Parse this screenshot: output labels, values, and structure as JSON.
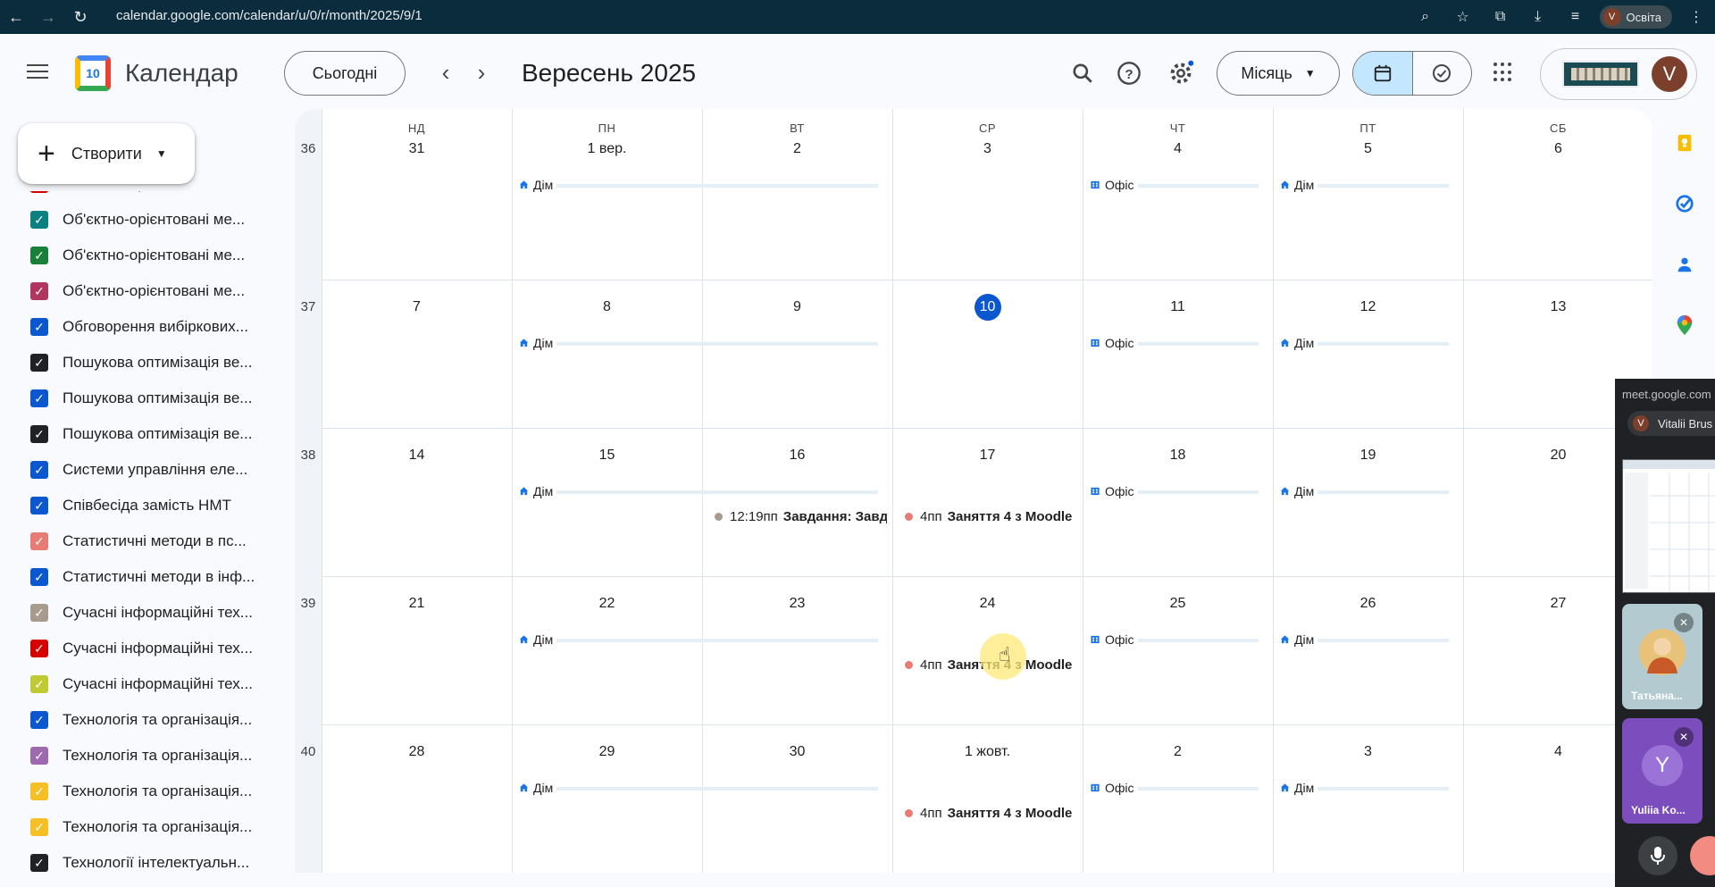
{
  "browser": {
    "url": "calendar.google.com/calendar/u/0/r/month/2025/9/1",
    "profile_initial": "V",
    "profile_name": "Освіта"
  },
  "header": {
    "app_title": "Календар",
    "logo_day": "10",
    "today_label": "Сьогодні",
    "month_title": "Вересень 2025",
    "view_label": "Місяць",
    "account_initial": "V"
  },
  "sidebar": {
    "create_label": "Створити",
    "calendars": [
      {
        "label": "Об'єктно-орієнтовані ме...",
        "color": "#d50000"
      },
      {
        "label": "Об'єктно-орієнтовані ме...",
        "color": "#0b8080"
      },
      {
        "label": "Об'єктно-орієнтовані ме...",
        "color": "#188038"
      },
      {
        "label": "Об'єктно-орієнтовані ме...",
        "color": "#b1365f"
      },
      {
        "label": "Обговорення вибіркових...",
        "color": "#0b57d0"
      },
      {
        "label": "Пошукова оптимізація ве...",
        "color": "#202124"
      },
      {
        "label": "Пошукова оптимізація ве...",
        "color": "#0b57d0"
      },
      {
        "label": "Пошукова оптимізація ве...",
        "color": "#202124"
      },
      {
        "label": "Системи управління еле...",
        "color": "#0b57d0"
      },
      {
        "label": "Співбесіда замість НМТ",
        "color": "#0b57d0"
      },
      {
        "label": "Статистичні методи в пс...",
        "color": "#e67c73"
      },
      {
        "label": "Статистичні методи в інф...",
        "color": "#0b57d0"
      },
      {
        "label": "Сучасні інформаційні тех...",
        "color": "#a79b8e"
      },
      {
        "label": "Сучасні інформаційні тех...",
        "color": "#d50000"
      },
      {
        "label": "Сучасні інформаційні тех...",
        "color": "#c0ca33"
      },
      {
        "label": "Технологія та організація...",
        "color": "#0b57d0"
      },
      {
        "label": "Технологія та організація...",
        "color": "#9e69af"
      },
      {
        "label": "Технологія та організація...",
        "color": "#f6bf26"
      },
      {
        "label": "Технологія та організація...",
        "color": "#f6bf26"
      },
      {
        "label": "Технології інтелектуальн...",
        "color": "#202124"
      }
    ]
  },
  "calendar": {
    "weekdays": [
      "НД",
      "ПН",
      "ВТ",
      "СР",
      "ЧТ",
      "ПТ",
      "СБ"
    ],
    "weeks": [
      {
        "num": "36",
        "days": [
          "31",
          "1 вер.",
          "2",
          "3",
          "4",
          "5",
          "6"
        ]
      },
      {
        "num": "37",
        "days": [
          "7",
          "8",
          "9",
          "10",
          "11",
          "12",
          "13"
        ]
      },
      {
        "num": "38",
        "days": [
          "14",
          "15",
          "16",
          "17",
          "18",
          "19",
          "20"
        ]
      },
      {
        "num": "39",
        "days": [
          "21",
          "22",
          "23",
          "24",
          "25",
          "26",
          "27"
        ]
      },
      {
        "num": "40",
        "days": [
          "28",
          "29",
          "30",
          "1 жовт.",
          "2",
          "3",
          "4"
        ]
      }
    ],
    "today": "10",
    "location_home": "Дім",
    "location_office": "Офіс",
    "events": {
      "task_time": "12:19пп",
      "task_title": "Завдання: Завдання",
      "class_time": "4пп",
      "class_title": "Заняття 4 з Moodle"
    }
  },
  "meet": {
    "url": "meet.google.com",
    "user_initial": "V",
    "user_name": "Vitalii Brus",
    "participant_1": "Татьяна...",
    "participant_2_initial": "Y",
    "participant_2": "Yuliia Ko..."
  }
}
